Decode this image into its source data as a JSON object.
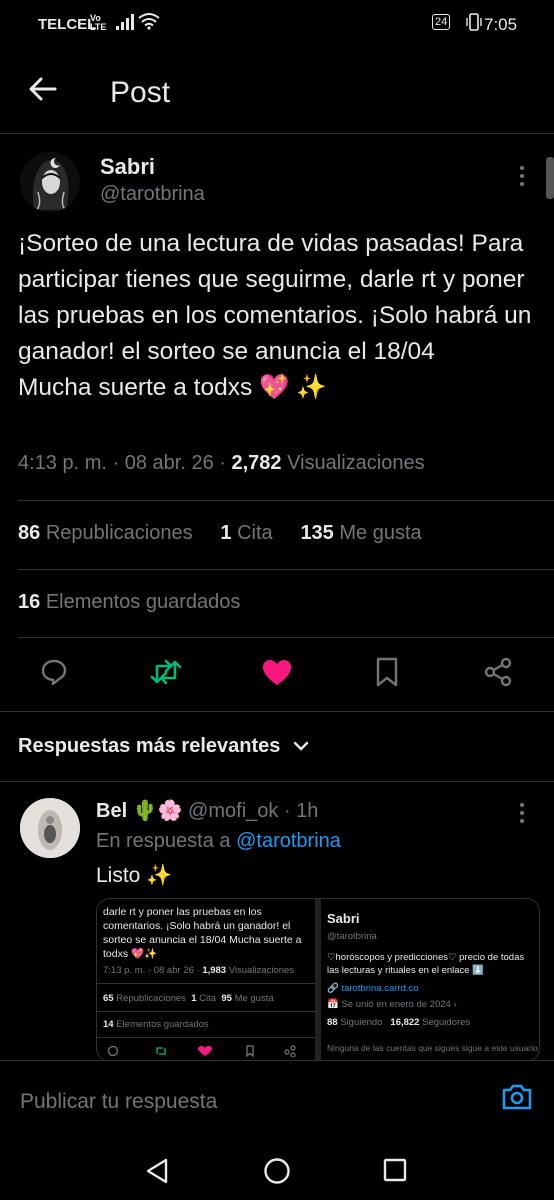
{
  "status_bar": {
    "carrier": "TELCEL",
    "volte_top": "Vo",
    "volte_bottom": "LTE",
    "battery": "24",
    "time": "7:05"
  },
  "header": {
    "title": "Post"
  },
  "author": {
    "name": "Sabri",
    "handle": "@tarotbrina"
  },
  "post": {
    "text": "¡Sorteo de una lectura de vidas pasadas! Para participar tienes que seguirme, darle rt y poner las pruebas en los comentarios. ¡Solo habrá un ganador! el sorteo se anuncia el 18/04\nMucha suerte a todxs 💖 ✨",
    "time": "4:13 p. m.",
    "sep": "·",
    "date": "08 abr. 26",
    "views": "2,782",
    "views_label": "Visualizaciones"
  },
  "stats": {
    "reposts": "86",
    "reposts_label": "Republicaciones",
    "quotes": "1",
    "quotes_label": "Cita",
    "likes": "135",
    "likes_label": "Me gusta",
    "bookmarks": "16",
    "bookmarks_label": "Elementos guardados"
  },
  "actions": {
    "icons": [
      "reply-icon",
      "repost-icon",
      "like-icon",
      "bookmark-icon",
      "share-icon"
    ],
    "repost_color": "#00ba7c",
    "like_color": "#f91880"
  },
  "replies_sort": {
    "label": "Respuestas más relevantes"
  },
  "reply": {
    "name": "Bel 🌵🌸",
    "handle": "@mofi_ok",
    "sep": "·",
    "time": "1h",
    "in_reply_label": "En respuesta a",
    "in_reply_handle": "@tarotbrina",
    "text": "Listo ✨",
    "image_left": {
      "text": "darle rt y poner las pruebas en los comentarios. ¡Solo habrá un ganador! el sorteo se anuncia el 18/04 Mucha suerte a todxs 💖✨",
      "time": "7:13 p. m.",
      "date": "08 abr 26",
      "views": "1,983",
      "views_label": "Visualizaciones",
      "reposts": "65",
      "reposts_label": "Republicaciones",
      "quotes": "1",
      "quotes_label": "Cita",
      "likes": "95",
      "likes_label": "Me gusta",
      "bookmarks": "14",
      "bookmarks_label": "Elementos guardados"
    },
    "image_right": {
      "name": "Sabri",
      "handle": "@tarotbrina",
      "bio": "♡horóscopos y predicciones♡ precio de todas las lecturas y rituales en el enlace ⬇️",
      "link": "tarotbrina.carrd.co",
      "joined": "Se unió en enero de 2024",
      "following": "88",
      "following_label": "Siguiendo",
      "followers": "16,822",
      "followers_label": "Seguidores",
      "note": "Ninguna de las cuentas que sigues sigue a este usuario"
    }
  },
  "composer": {
    "placeholder": "Publicar tu respuesta"
  },
  "accent": "#1d9bf0"
}
